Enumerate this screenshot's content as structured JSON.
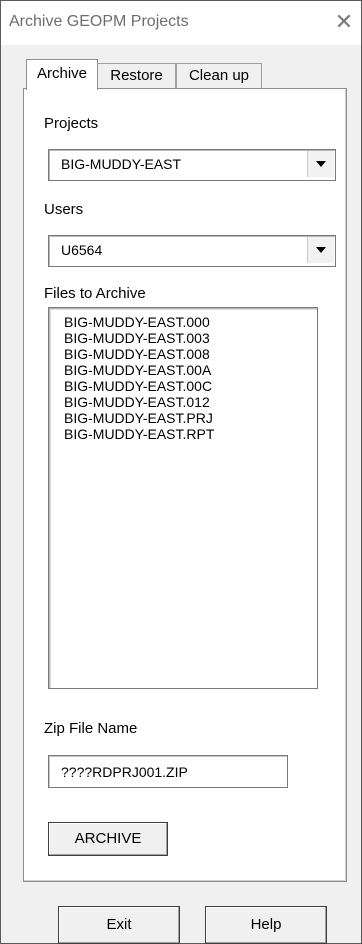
{
  "window": {
    "title": "Archive GEOPM Projects",
    "close_glyph": "✕"
  },
  "tabs": [
    {
      "label": "Archive",
      "active": true
    },
    {
      "label": "Restore",
      "active": false
    },
    {
      "label": "Clean up",
      "active": false
    }
  ],
  "projects": {
    "label": "Projects",
    "value": "BIG-MUDDY-EAST"
  },
  "users": {
    "label": "Users",
    "value": "U6564"
  },
  "files": {
    "label": "Files to Archive",
    "items": [
      "BIG-MUDDY-EAST.000",
      "BIG-MUDDY-EAST.003",
      "BIG-MUDDY-EAST.008",
      "BIG-MUDDY-EAST.00A",
      "BIG-MUDDY-EAST.00C",
      "BIG-MUDDY-EAST.012",
      "BIG-MUDDY-EAST.PRJ",
      "BIG-MUDDY-EAST.RPT"
    ]
  },
  "zip": {
    "label": "Zip File Name",
    "value": "????RDPRJ001.ZIP"
  },
  "buttons": {
    "archive": "ARCHIVE",
    "exit": "Exit",
    "help": "Help"
  }
}
